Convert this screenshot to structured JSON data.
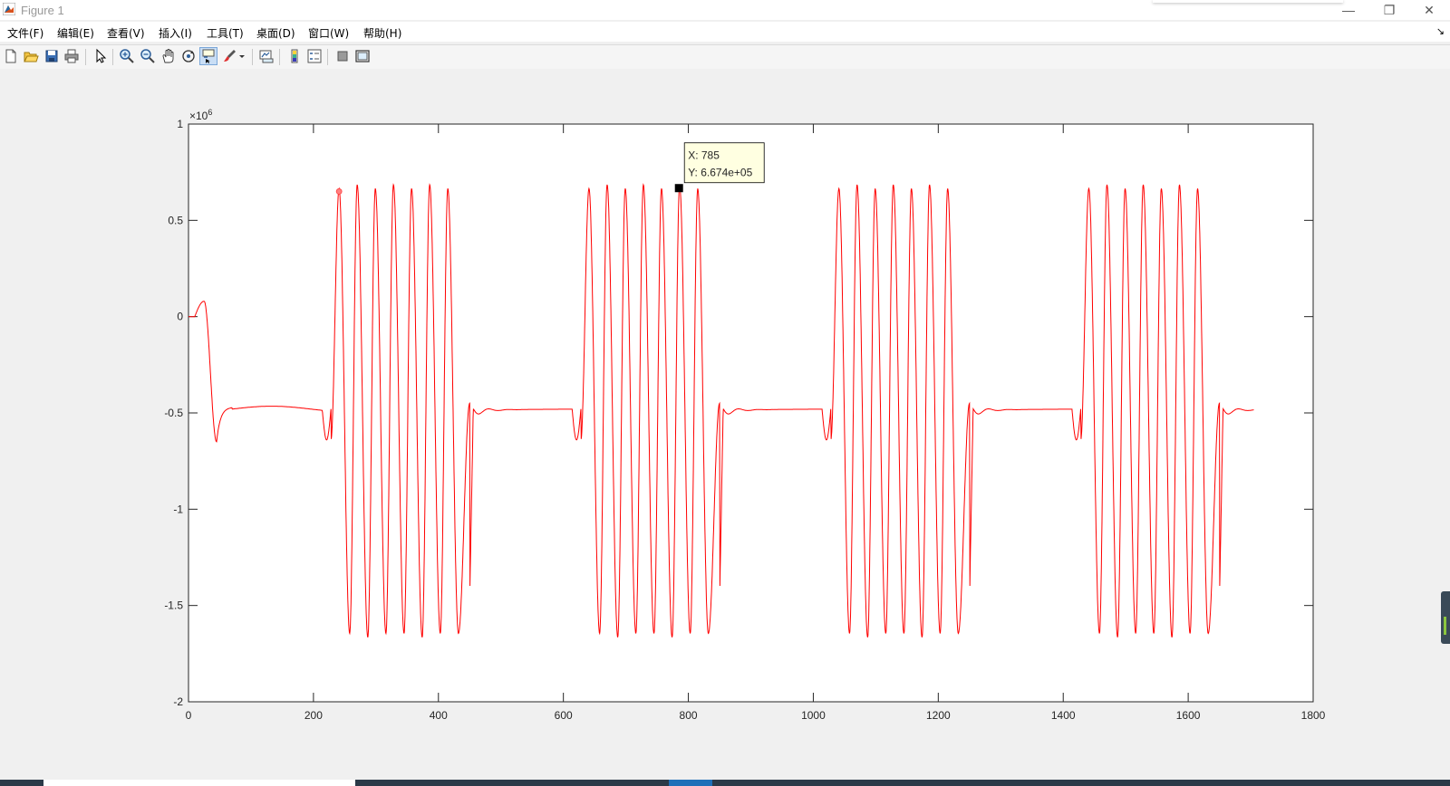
{
  "window": {
    "title": "Figure 1",
    "controls": [
      "—",
      "❐",
      "✕"
    ]
  },
  "menu": {
    "items": [
      "文件(F)",
      "编辑(E)",
      "查看(V)",
      "插入(I)",
      "工具(T)",
      "桌面(D)",
      "窗口(W)",
      "帮助(H)"
    ],
    "overflow_icon": "dock-arrow-icon"
  },
  "toolbar": {
    "tools": [
      {
        "name": "new-figure",
        "icon": "new-file-icon"
      },
      {
        "name": "open-file",
        "icon": "open-folder-icon"
      },
      {
        "name": "save-figure",
        "icon": "save-icon"
      },
      {
        "name": "print-figure",
        "icon": "print-icon"
      },
      {
        "name": "edit-plot",
        "icon": "arrow-cursor-icon"
      },
      {
        "name": "zoom-in",
        "icon": "zoom-in-icon"
      },
      {
        "name": "zoom-out",
        "icon": "zoom-out-icon"
      },
      {
        "name": "pan",
        "icon": "hand-icon"
      },
      {
        "name": "rotate-3d",
        "icon": "rotate-icon"
      },
      {
        "name": "data-cursor",
        "icon": "data-cursor-icon",
        "pressed": true
      },
      {
        "name": "brush",
        "icon": "brush-icon"
      },
      {
        "name": "link-plot",
        "icon": "link-plot-icon"
      },
      {
        "name": "insert-colorbar",
        "icon": "colorbar-icon"
      },
      {
        "name": "insert-legend",
        "icon": "legend-icon"
      },
      {
        "name": "hide-plot-tools",
        "icon": "hide-tools-icon"
      },
      {
        "name": "show-plot-tools",
        "icon": "show-tools-icon"
      }
    ]
  },
  "chart_data": {
    "type": "line",
    "series": [
      {
        "color": "#ff0000",
        "segments": [
          {
            "kind": "settle",
            "start": 0,
            "end": 228
          },
          {
            "kind": "burst",
            "start": 228,
            "end": 450,
            "peaks": [
              241,
              270,
              299,
              328,
              357,
              386,
              415
            ],
            "troughs": [
              258,
              287,
              316,
              345,
              374,
              403,
              432
            ]
          },
          {
            "kind": "settle",
            "start": 450,
            "end": 628
          },
          {
            "kind": "burst",
            "start": 628,
            "end": 850,
            "peaks": [
              641,
              670,
              699,
              728,
              757,
              786,
              815
            ],
            "troughs": [
              658,
              687,
              716,
              745,
              774,
              803,
              832
            ]
          },
          {
            "kind": "settle",
            "start": 850,
            "end": 1028
          },
          {
            "kind": "burst",
            "start": 1028,
            "end": 1250,
            "peaks": [
              1041,
              1070,
              1099,
              1128,
              1157,
              1186,
              1215
            ],
            "troughs": [
              1058,
              1087,
              1116,
              1145,
              1174,
              1203,
              1232
            ]
          },
          {
            "kind": "settle",
            "start": 1250,
            "end": 1428
          },
          {
            "kind": "burst",
            "start": 1428,
            "end": 1650,
            "peaks": [
              1441,
              1470,
              1499,
              1528,
              1557,
              1586,
              1615
            ],
            "troughs": [
              1458,
              1487,
              1516,
              1545,
              1574,
              1603,
              1632
            ]
          },
          {
            "kind": "settle",
            "start": 1650,
            "end": 1705
          }
        ],
        "peak_value": 670000,
        "trough_value": -1650000,
        "baseline_value": -480000,
        "initial_bump": {
          "x": 25,
          "y": 80000
        }
      }
    ],
    "xlim": [
      0,
      1800
    ],
    "ylim": [
      -2000000,
      1000000
    ],
    "xticks": [
      0,
      200,
      400,
      600,
      800,
      1000,
      1200,
      1400,
      1600,
      1800
    ],
    "yticks": [
      -2,
      -1.5,
      -1,
      -0.5,
      0,
      0.5,
      1
    ],
    "y_exponent_label": "×10",
    "y_exponent_power": "6",
    "grid": false,
    "datatip": {
      "x": 785,
      "y": 667400,
      "lines": [
        "X: 785",
        "Y: 6.674e+05"
      ]
    }
  },
  "colors": {
    "line": "#ff0000",
    "axes_bg": "#ffffff",
    "figure_bg": "#f0f0f0",
    "datatip_bg": "#ffffe1"
  }
}
